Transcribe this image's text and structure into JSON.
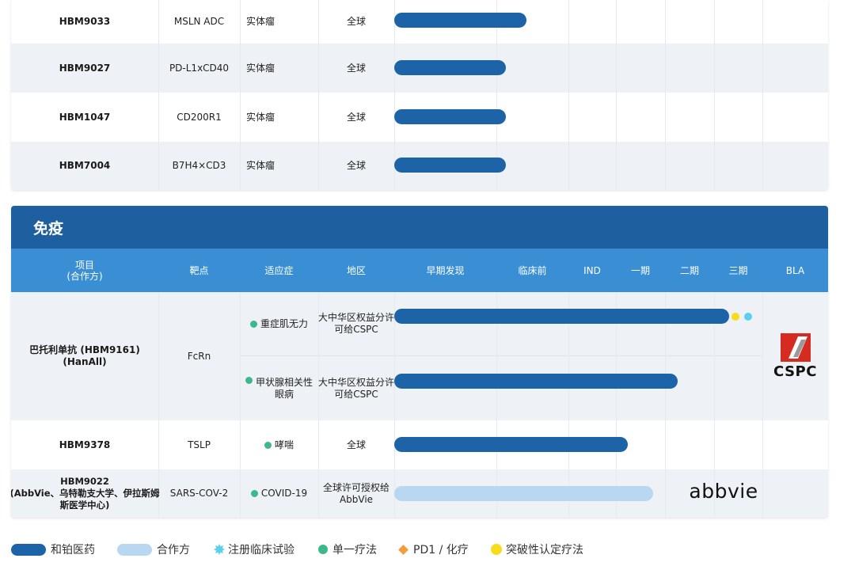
{
  "top_rows": [
    {
      "project": "HBM9033",
      "target": "MSLN ADC",
      "indication": "实体瘤",
      "region": "全球"
    },
    {
      "project": "HBM9027",
      "target": "PD-L1xCD40",
      "indication": "实体瘤",
      "region": "全球"
    },
    {
      "project": "HBM1047",
      "target": "CD200R1",
      "indication": "实体瘤",
      "region": "全球"
    },
    {
      "project": "HBM7004",
      "target": "B7H4×CD3",
      "indication": "实体瘤",
      "region": "全球"
    }
  ],
  "section": {
    "title": "免疫"
  },
  "headers": {
    "project_line1": "项目",
    "project_line2": "(合作方)",
    "target": "靶点",
    "indication": "适应症",
    "region": "地区",
    "stages": [
      "早期发现",
      "临床前",
      "IND",
      "一期",
      "二期",
      "三期",
      "BLA"
    ]
  },
  "immune": {
    "bato": {
      "project_line1": "巴托利单抗 (HBM9161)",
      "project_line2": "(HanAll)",
      "target": "FcRn",
      "ind1": "重症肌无力",
      "region1_line1": "大中华区权益分许",
      "region1_line2": "可给CSPC",
      "ind2_line1": "甲状腺相关性",
      "ind2_line2": "眼病",
      "region2_line1": "大中华区权益分许",
      "region2_line2": "可给CSPC",
      "partner_logo": "CSPC"
    },
    "hbm9378": {
      "project": "HBM9378",
      "target": "TSLP",
      "indication": "哮喘",
      "region": "全球"
    },
    "hbm9022": {
      "project_line1": "HBM9022",
      "project_line2": "(AbbVie、乌特勒支大学、伊拉斯姆",
      "project_line3": "斯医学中心)",
      "target": "SARS-COV-2",
      "indication": "COVID-19",
      "region_line1": "全球许可授权给",
      "region_line2": "AbbVie",
      "partner_logo": "abbvie"
    }
  },
  "legend": {
    "harbour": "和铂医药",
    "partner": "合作方",
    "registration": "注册临床试验",
    "mono": "单一疗法",
    "pd1": "PD1 / 化疗",
    "breakthrough": "突破性认定疗法"
  },
  "colors": {
    "harbour": "#1c63a8",
    "partner": "#b9d7f0",
    "section": "#1d5f9f",
    "header": "#3a8fd4",
    "registration": "#5bd0ee",
    "mono": "#3db88b",
    "pd1": "#f39c3c",
    "breakthrough": "#f7dc1c"
  }
}
